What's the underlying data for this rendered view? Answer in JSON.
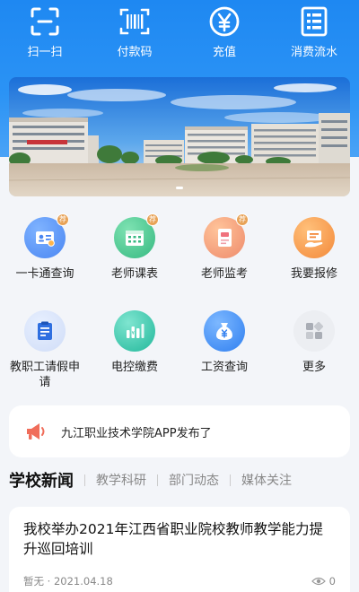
{
  "quick_actions": [
    {
      "label": "扫一扫",
      "icon": "scan-icon"
    },
    {
      "label": "付款码",
      "icon": "payment-code-icon"
    },
    {
      "label": "充值",
      "icon": "yuan-recharge-icon"
    },
    {
      "label": "消费流水",
      "icon": "transactions-list-icon"
    }
  ],
  "banner": {
    "slides": 2,
    "active_index": 0
  },
  "apps_row1": [
    {
      "label": "一卡通查询",
      "icon": "id-card-icon",
      "color": "#4a8df5",
      "badge": "荐"
    },
    {
      "label": "老师课表",
      "icon": "timetable-icon",
      "color": "#43c48b",
      "badge": "荐"
    },
    {
      "label": "老师监考",
      "icon": "exam-invigilation-icon",
      "color": "#f0727d",
      "badge": "荐"
    },
    {
      "label": "我要报修",
      "icon": "repair-icon",
      "color": "#f59a3b",
      "badge": ""
    }
  ],
  "apps_row2": [
    {
      "label": "教职工请假申请",
      "icon": "leave-request-icon",
      "color": "#3f7fe9",
      "badge": ""
    },
    {
      "label": "电控缴费",
      "icon": "electricity-payment-icon",
      "color": "#2ebfa5",
      "badge": ""
    },
    {
      "label": "工资查询",
      "icon": "salary-query-icon",
      "color": "#3d8ef3",
      "badge": ""
    },
    {
      "label": "更多",
      "icon": "more-apps-icon",
      "color": "#b8bcc4",
      "badge": ""
    }
  ],
  "notice": {
    "icon": "megaphone-icon",
    "text": "九江职业技术学院APP发布了"
  },
  "news_tabs": [
    "学校新闻",
    "教学科研",
    "部门动态",
    "媒体关注"
  ],
  "news": [
    {
      "title": "我校举办2021年江西省职业院校教师教学能力提升巡回培训",
      "source": "暂无",
      "date": "2021.04.18",
      "views": "0"
    }
  ]
}
